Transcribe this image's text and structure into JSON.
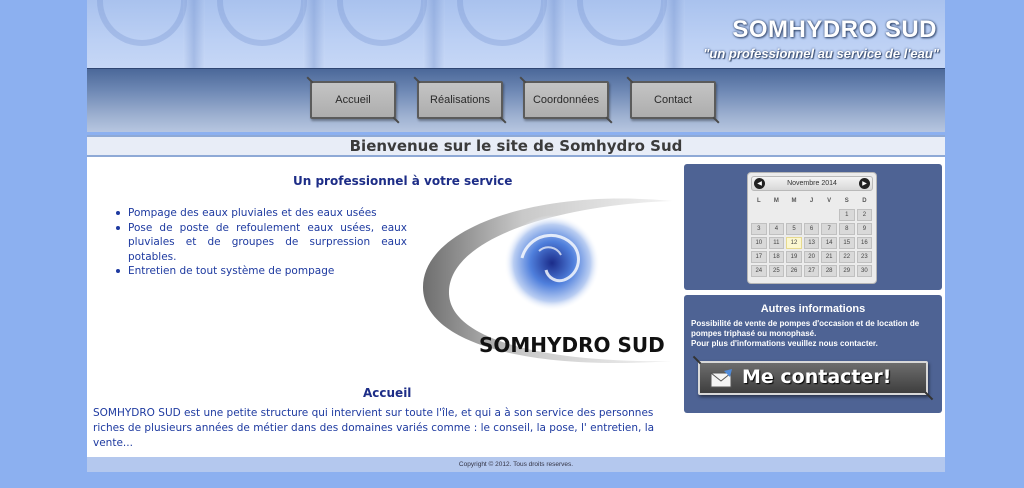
{
  "header": {
    "site_title": "SOMHYDRO SUD",
    "slogan": "\"un professionnel au service de l'eau\""
  },
  "nav": {
    "items": [
      {
        "label": "Accueil"
      },
      {
        "label": "Réalisations"
      },
      {
        "label": "Coordonnées"
      },
      {
        "label": "Contact"
      }
    ]
  },
  "welcome": {
    "title": "Bienvenue sur le site de Somhydro Sud"
  },
  "main": {
    "content_title": "Un professionnel à votre service",
    "services": [
      "Pompage des eaux pluviales et des eaux usées",
      "Pose de poste de refoulement eaux usées, eaux pluviales et de groupes de surpression eaux potables.",
      "Entretien de tout système de pompage"
    ],
    "logo_text": "SOMHYDRO SUD",
    "accueil_heading": "Accueil",
    "intro_text": "SOMHYDRO SUD est une petite structure qui intervient sur toute l'île, et qui a à son service des personnes riches de plusieurs années de métier dans des domaines variés comme : le conseil, la pose, l' entretien, la vente..."
  },
  "calendar": {
    "month_label": "Novembre 2014",
    "prev_icon": "arrow-left-icon",
    "next_icon": "arrow-right-icon",
    "weekdays": [
      "L",
      "M",
      "M",
      "J",
      "V",
      "S",
      "D"
    ],
    "weeks": [
      [
        "",
        "",
        "",
        "",
        "",
        "1",
        "2"
      ],
      [
        "3",
        "4",
        "5",
        "6",
        "7",
        "8",
        "9"
      ],
      [
        "10",
        "11",
        "12",
        "13",
        "14",
        "15",
        "16"
      ],
      [
        "17",
        "18",
        "19",
        "20",
        "21",
        "22",
        "23"
      ],
      [
        "24",
        "25",
        "26",
        "27",
        "28",
        "29",
        "30"
      ]
    ],
    "today": "12"
  },
  "info": {
    "title": "Autres informations",
    "line1": "Possibilité de vente de pompes d'occasion et de location de pompes triphasé ou monophasé.",
    "line2": "Pour plus d'informations veuillez nous contacter.",
    "contact_button": "Me contacter!",
    "contact_icon": "mail-icon"
  },
  "footer": {
    "copyright": "Copyright © 2012. Tous droits reserves."
  },
  "colors": {
    "page_bg": "#8cb0f0",
    "panel_bg": "#4e6394",
    "text_blue": "#1e3aa0",
    "heading_blue": "#1d2d87"
  }
}
